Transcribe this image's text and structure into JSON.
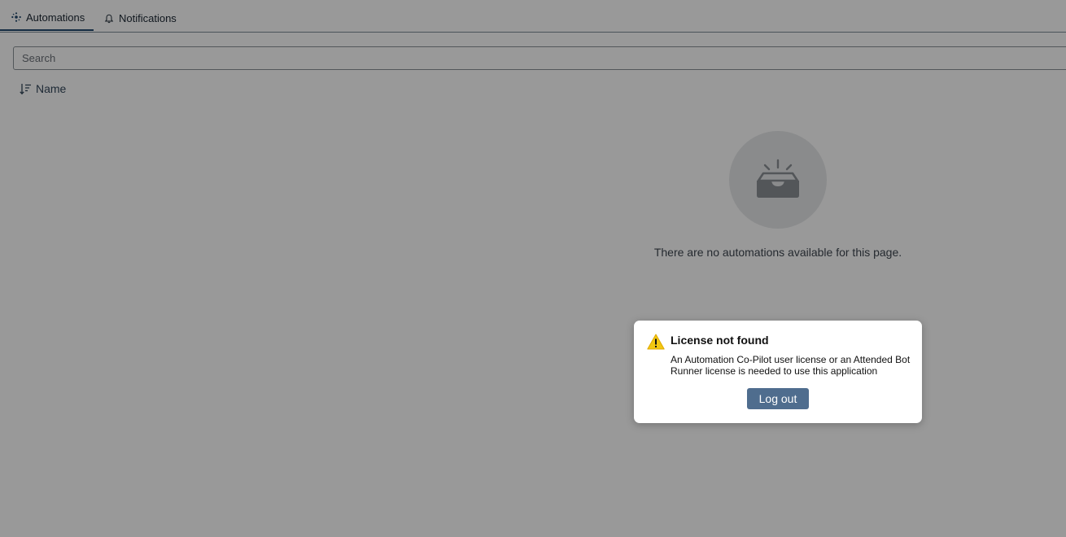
{
  "tabs": {
    "automations": {
      "label": "Automations",
      "icon": "automations-icon"
    },
    "notifications": {
      "label": "Notifications",
      "icon": "bell-icon"
    }
  },
  "search": {
    "placeholder": "Search",
    "value": ""
  },
  "sort": {
    "label": "Name",
    "icon": "sort-descending-icon"
  },
  "empty_state": {
    "icon": "empty-inbox-icon",
    "message": "There are no automations available for this page."
  },
  "dialog": {
    "icon": "warning-icon",
    "title": "License not found",
    "message": "An Automation Co-Pilot user license or an Attended Bot Runner license is needed to use this application",
    "button_label": "Log out"
  },
  "colors": {
    "accent": "#244a6e",
    "button": "#4f6d8e",
    "warning": "#f2c811",
    "overlay": "rgba(0,0,0,0.40)"
  }
}
